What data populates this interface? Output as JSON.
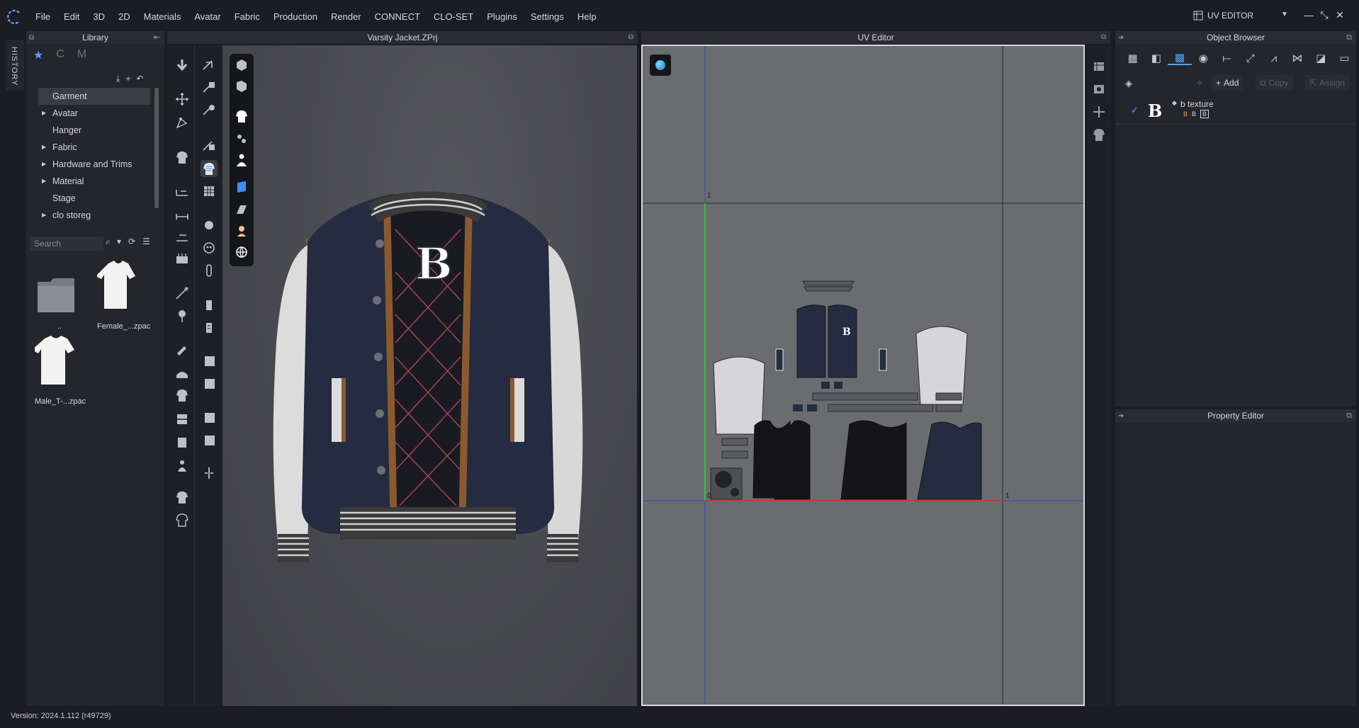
{
  "menubar": {
    "items": [
      "File",
      "Edit",
      "3D",
      "2D",
      "Materials",
      "Avatar",
      "Fabric",
      "Production",
      "Render",
      "CONNECT",
      "CLO-SET",
      "Plugins",
      "Settings",
      "Help"
    ],
    "mode_label": "UV EDITOR"
  },
  "history_tab": {
    "label": "HISTORY"
  },
  "library": {
    "title": "Library",
    "tree": [
      {
        "label": "Garment",
        "expandable": false,
        "selected": true
      },
      {
        "label": "Avatar",
        "expandable": true,
        "selected": false
      },
      {
        "label": "Hanger",
        "expandable": false,
        "selected": false
      },
      {
        "label": "Fabric",
        "expandable": true,
        "selected": false
      },
      {
        "label": "Hardware and Trims",
        "expandable": true,
        "selected": false
      },
      {
        "label": "Material",
        "expandable": true,
        "selected": false
      },
      {
        "label": "Stage",
        "expandable": false,
        "selected": false
      },
      {
        "label": "clo storeg",
        "expandable": true,
        "selected": false
      }
    ],
    "search_placeholder": "Search",
    "files": [
      {
        "label": "..",
        "kind": "folder"
      },
      {
        "label": "Female_...zpac",
        "kind": "garment"
      },
      {
        "label": "Male_T-...zpac",
        "kind": "garment"
      }
    ]
  },
  "viewport3d": {
    "title": "Varsity Jacket.ZPrj"
  },
  "uv_editor": {
    "title": "UV Editor",
    "axis_labels": [
      "1",
      "0",
      "1"
    ]
  },
  "object_browser": {
    "title": "Object Browser",
    "actions": {
      "add": "Add",
      "copy": "Copy",
      "assign": "Assign"
    },
    "items": [
      {
        "name": "b texture",
        "badge": "B",
        "checked": true
      }
    ]
  },
  "property_editor": {
    "title": "Property Editor"
  },
  "status": {
    "version": "Version: 2024.1.112 (r49729)"
  },
  "colors": {
    "accent": "#4da3ff",
    "navy": "#252b40",
    "cream": "#dcdcdc",
    "brown": "#8a5a2e"
  }
}
